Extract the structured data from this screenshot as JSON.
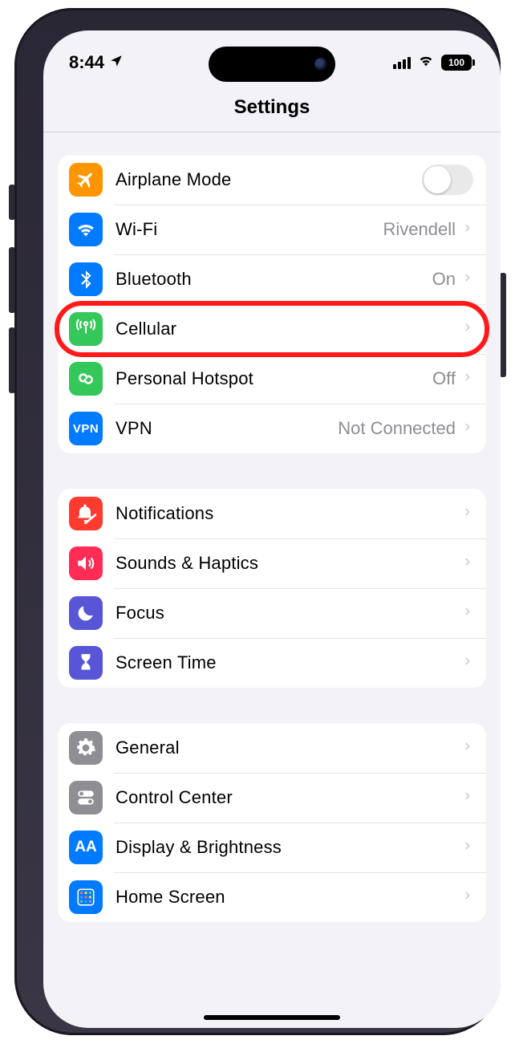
{
  "status_bar": {
    "time": "8:44",
    "battery_text": "100"
  },
  "header": {
    "title": "Settings"
  },
  "groups": [
    {
      "rows": [
        {
          "key": "airplane",
          "label": "Airplane Mode",
          "value": "",
          "type": "toggle",
          "toggle_on": false,
          "icon": "airplane-icon",
          "icon_bg": "bg-orange"
        },
        {
          "key": "wifi",
          "label": "Wi-Fi",
          "value": "Rivendell",
          "type": "link",
          "icon": "wifi-icon",
          "icon_bg": "bg-blue"
        },
        {
          "key": "bluetooth",
          "label": "Bluetooth",
          "value": "On",
          "type": "link",
          "icon": "bluetooth-icon",
          "icon_bg": "bg-blue"
        },
        {
          "key": "cellular",
          "label": "Cellular",
          "value": "",
          "type": "link",
          "icon": "cellular-icon",
          "icon_bg": "bg-green",
          "highlighted": true
        },
        {
          "key": "hotspot",
          "label": "Personal Hotspot",
          "value": "Off",
          "type": "link",
          "icon": "hotspot-icon",
          "icon_bg": "bg-green"
        },
        {
          "key": "vpn",
          "label": "VPN",
          "value": "Not Connected",
          "type": "link",
          "icon": "vpn-icon",
          "icon_bg": "bg-blue"
        }
      ]
    },
    {
      "rows": [
        {
          "key": "notifications",
          "label": "Notifications",
          "value": "",
          "type": "link",
          "icon": "notifications-icon",
          "icon_bg": "bg-red"
        },
        {
          "key": "sounds",
          "label": "Sounds & Haptics",
          "value": "",
          "type": "link",
          "icon": "sounds-icon",
          "icon_bg": "bg-pink"
        },
        {
          "key": "focus",
          "label": "Focus",
          "value": "",
          "type": "link",
          "icon": "focus-icon",
          "icon_bg": "bg-indigo"
        },
        {
          "key": "screentime",
          "label": "Screen Time",
          "value": "",
          "type": "link",
          "icon": "screentime-icon",
          "icon_bg": "bg-indigo"
        }
      ]
    },
    {
      "rows": [
        {
          "key": "general",
          "label": "General",
          "value": "",
          "type": "link",
          "icon": "general-icon",
          "icon_bg": "bg-gray"
        },
        {
          "key": "control-center",
          "label": "Control Center",
          "value": "",
          "type": "link",
          "icon": "control-center-icon",
          "icon_bg": "bg-gray"
        },
        {
          "key": "display",
          "label": "Display & Brightness",
          "value": "",
          "type": "link",
          "icon": "display-icon",
          "icon_bg": "bg-blue"
        },
        {
          "key": "home-screen",
          "label": "Home Screen",
          "value": "",
          "type": "link",
          "icon": "home-screen-icon",
          "icon_bg": "bg-blue"
        }
      ]
    }
  ],
  "icon_labels": {
    "vpn": "VPN",
    "display": "AA"
  },
  "highlight_color": "#ff1a1a"
}
